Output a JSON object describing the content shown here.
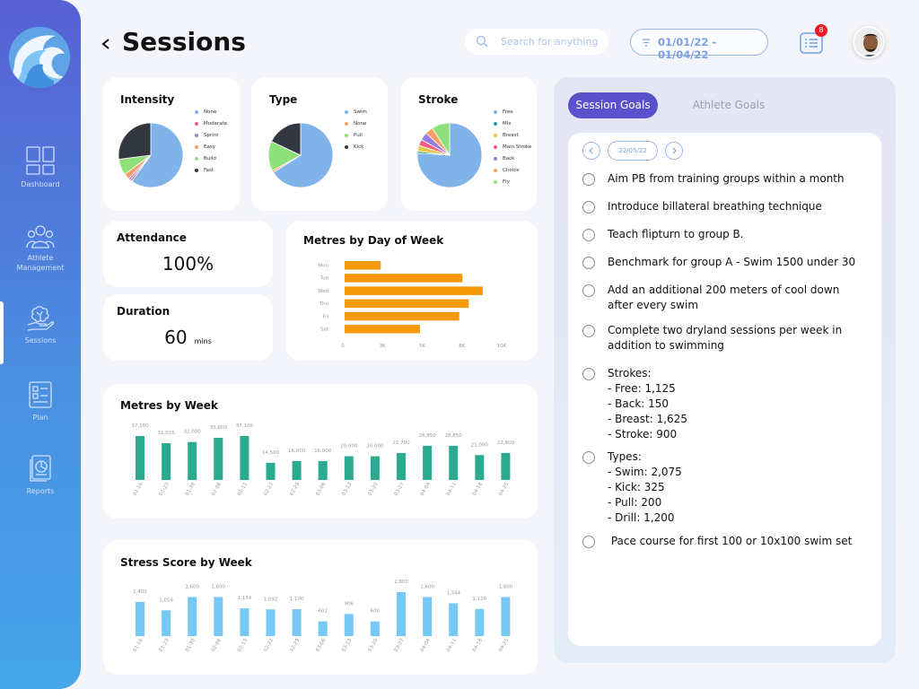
{
  "header": {
    "title": "Sessions",
    "search_placeholder": "Search for anything",
    "date_range": "01/01/22 - 01/04/22",
    "notification_count": "8"
  },
  "sidebar": {
    "items": [
      {
        "label": "Dashboard",
        "icon": "dashboard-icon"
      },
      {
        "label": "Athlete Management",
        "icon": "athletes-icon"
      },
      {
        "label": "Sessions",
        "icon": "sessions-icon"
      },
      {
        "label": "Plan",
        "icon": "plan-icon"
      },
      {
        "label": "Reports",
        "icon": "reports-icon"
      }
    ]
  },
  "intensity": {
    "title": "Intensity",
    "legend": [
      {
        "label": "None",
        "color": "#7fb3ea"
      },
      {
        "label": "Moderate",
        "color": "#f05a7e"
      },
      {
        "label": "Sprint",
        "color": "#9b7be0"
      },
      {
        "label": "Easy",
        "color": "#f5a06a"
      },
      {
        "label": "Build",
        "color": "#8ee07a"
      },
      {
        "label": "Fast",
        "color": "#333740"
      }
    ]
  },
  "type": {
    "title": "Type",
    "legend": [
      {
        "label": "Swim",
        "color": "#7fb3ea"
      },
      {
        "label": "None",
        "color": "#f5a06a"
      },
      {
        "label": "Pull",
        "color": "#8ee07a"
      },
      {
        "label": "Kick",
        "color": "#333740"
      }
    ]
  },
  "stroke": {
    "title": "Stroke",
    "legend": [
      {
        "label": "Free",
        "color": "#7fb3ea"
      },
      {
        "label": "Mix",
        "color": "#2a9d8f"
      },
      {
        "label": "Breast",
        "color": "#e8c84a"
      },
      {
        "label": "Main Stroke",
        "color": "#f05a7e"
      },
      {
        "label": "Back",
        "color": "#9b7be0"
      },
      {
        "label": "Choice",
        "color": "#f5a06a"
      },
      {
        "label": "Fly",
        "color": "#8ee07a"
      }
    ]
  },
  "attendance": {
    "label": "Attendance",
    "value": "100%"
  },
  "duration": {
    "label": "Duration",
    "value": "60",
    "unit": "mins"
  },
  "metres_by_day": {
    "title": "Metres by Day of Week"
  },
  "metres_by_week": {
    "title": "Metres by Week"
  },
  "stress_by_week": {
    "title": "Stress Score by Week"
  },
  "goals": {
    "tabs": [
      "Session Goals",
      "Athlete Goals"
    ],
    "date": "22/05/22",
    "items": [
      "Aim PB from training groups within a month",
      "Introduce billateral breathing technique",
      "Teach flipturn to group B.",
      "Benchmark for group A - Swim 1500 under 30",
      "Add an additional 200 meters of cool down after every swim",
      "Complete two dryland sessions per week in addition to swimming",
      "Strokes:\n- Free: 1,125\n- Back: 150\n- Breast: 1,625\n- Stroke: 900",
      "Types:\n- Swim: 2,075\n- Kick: 325\n- Pull: 200\n- Drill: 1,200",
      " Pace course for first 100 or 10x100 swim set"
    ]
  },
  "chart_data": [
    {
      "type": "pie",
      "title": "Intensity",
      "labels": [
        "None",
        "Moderate",
        "Sprint",
        "Easy",
        "Build",
        "Fast"
      ],
      "values": [
        60,
        1,
        1,
        3,
        8,
        27
      ]
    },
    {
      "type": "pie",
      "title": "Type",
      "labels": [
        "Swim",
        "None",
        "Pull",
        "Kick"
      ],
      "values": [
        66,
        1,
        15,
        18
      ]
    },
    {
      "type": "pie",
      "title": "Stroke",
      "labels": [
        "Free",
        "Mix",
        "Breast",
        "Main Stroke",
        "Back",
        "Choice",
        "Fly"
      ],
      "values": [
        76,
        1,
        3,
        3,
        4,
        4,
        9
      ]
    },
    {
      "type": "bar",
      "title": "Metres by Day of Week",
      "orientation": "horizontal",
      "categories": [
        "Mon",
        "Tue",
        "Wed",
        "Thu",
        "Fri",
        "Sat"
      ],
      "values": [
        2300,
        7500,
        8800,
        7900,
        7300,
        4800
      ],
      "xticks": [
        "0",
        "3K",
        "5K",
        "8K",
        "10K"
      ],
      "xlim": [
        0,
        10000
      ],
      "color": "#f5990a"
    },
    {
      "type": "bar",
      "title": "Metres by Week",
      "categories": [
        "01-16",
        "01-23",
        "01-30",
        "02-08",
        "02-15",
        "02-22",
        "02-29",
        "03-06",
        "03-13",
        "03-20",
        "03-27",
        "04-04",
        "04-11",
        "04-18",
        "04-25"
      ],
      "values": [
        37100,
        31025,
        32000,
        35600,
        37100,
        14500,
        16000,
        16000,
        20000,
        20000,
        22700,
        28850,
        28850,
        21000,
        22800
      ],
      "labels": [
        "37,100",
        "31,025",
        "32,000",
        "35,600",
        "37,100",
        "14,500",
        "16,000",
        "16,000",
        "20,000",
        "20,000",
        "22,700",
        "28,850",
        "28,850",
        "21,000",
        "22,800"
      ],
      "color": "#2aaa8f"
    },
    {
      "type": "bar",
      "title": "Stress Score by Week",
      "categories": [
        "01-16",
        "01-23",
        "01-30",
        "02-08",
        "02-15",
        "02-22",
        "02-29",
        "03-06",
        "03-13",
        "03-20",
        "03-27",
        "04-04",
        "04-11",
        "04-18",
        "04-25"
      ],
      "values": [
        1400,
        1054,
        1600,
        1600,
        1134,
        1092,
        1100,
        602,
        906,
        600,
        1800,
        1600,
        1344,
        1110,
        1600
      ],
      "labels": [
        "1,400",
        "1,054",
        "1,600",
        "1,600",
        "1,134",
        "1,092",
        "1,100",
        "602",
        "906",
        "600",
        "1,800",
        "1,600",
        "1,344",
        "1,110",
        "1,600"
      ],
      "color": "#76c8f5"
    }
  ]
}
